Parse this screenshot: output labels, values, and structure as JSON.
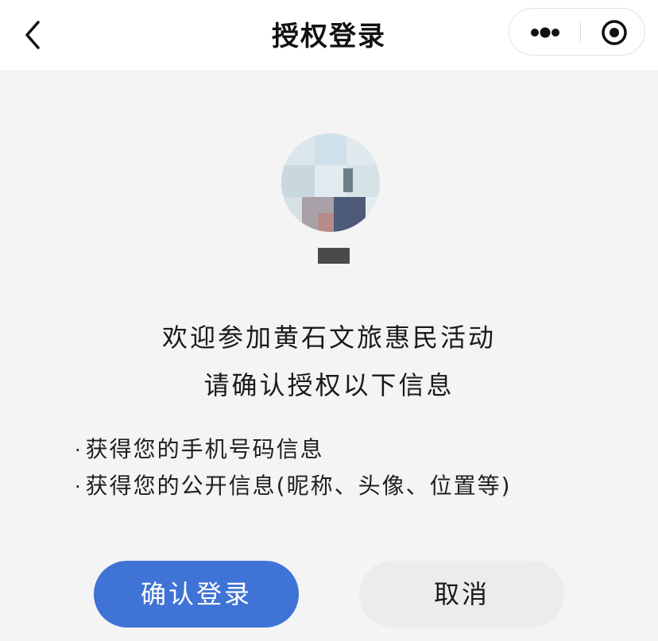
{
  "navbar": {
    "title": "授权登录",
    "back_icon": "chevron-left-icon",
    "more_icon": "more-dots-icon",
    "close_icon": "target-circle-icon"
  },
  "profile": {
    "avatar": "blurred-user-avatar"
  },
  "welcome": {
    "line1": "欢迎参加黄石文旅惠民活动",
    "line2": "请确认授权以下信息"
  },
  "permissions": [
    "获得您的手机号码信息",
    "获得您的公开信息(昵称、头像、位置等)"
  ],
  "permission_bullet": "·",
  "buttons": {
    "confirm_label": "确认登录",
    "cancel_label": "取消"
  },
  "colors": {
    "primary": "#3f73d6",
    "cancel_bg": "#ececec",
    "page_bg": "#f4f4f4"
  }
}
